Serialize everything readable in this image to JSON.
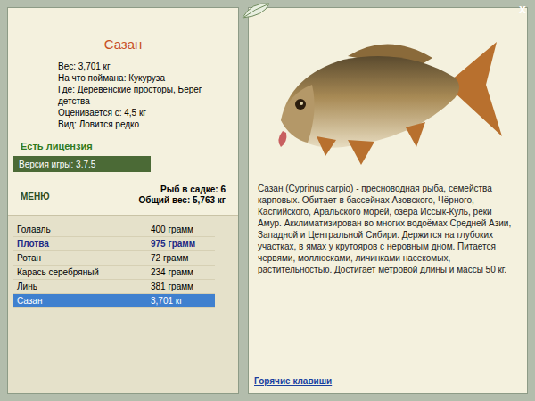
{
  "close": "x",
  "fish": {
    "title": "Сазан",
    "details": [
      "Вес: 3,701 кг",
      "На что поймана: Кукуруза",
      "Где: Деревенские просторы, Берег детства",
      "Оценивается с: 4,5 кг",
      "Вид: Ловится редко"
    ],
    "license": "Есть лицензия",
    "version": "Версия игры: 3.7.5",
    "description": "Сазан (Cyprinus carpio) - пресноводная рыба, семейства карповых. Обитает в бассейнах Азовского, Чёрного, Каспийского, Аральского морей, озера Иссык-Куль, реки Амур. Акклиматизирован во многих водоёмах Средней Азии, Западной и Центральной Сибири. Держится на глубоких участках, в ямах у крутояров с неровным дном. Питается червями, моллюсками, личинками насекомых, растительностью. Достигает метровой длины и массы 50 кг."
  },
  "menu": "МЕНЮ",
  "keepnet": {
    "count": "Рыб в садке: 6",
    "total": "Общий вес: 5,763 кг"
  },
  "catch": [
    {
      "name": "Голавль",
      "weight": "400 грамм",
      "selected": false,
      "record": false
    },
    {
      "name": "Плотва",
      "weight": "975 грамм",
      "selected": false,
      "record": true
    },
    {
      "name": "Ротан",
      "weight": "72 грамм",
      "selected": false,
      "record": false
    },
    {
      "name": "Карась серебряный",
      "weight": "234 грамм",
      "selected": false,
      "record": false
    },
    {
      "name": "Линь",
      "weight": "381 грамм",
      "selected": false,
      "record": false
    },
    {
      "name": "Сазан",
      "weight": "3,701 кг",
      "selected": true,
      "record": false
    }
  ],
  "hotkeys": "Горячие клавиши"
}
